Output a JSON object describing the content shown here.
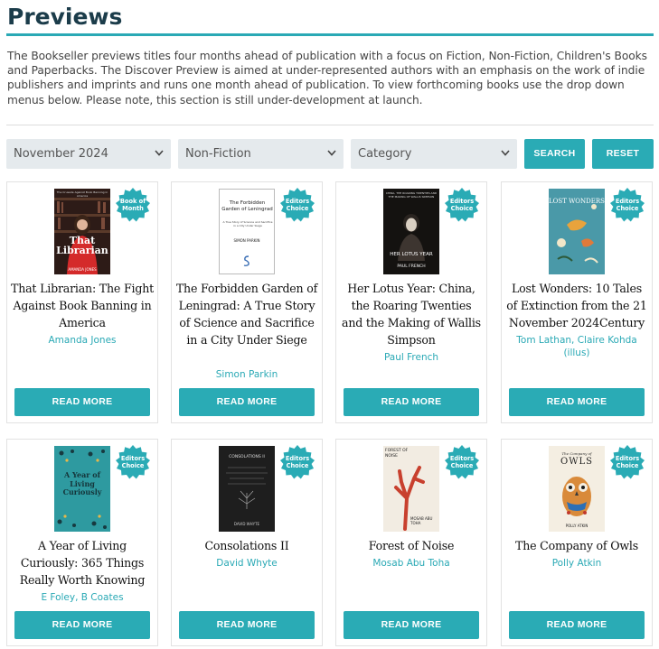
{
  "page": {
    "title": "Previews",
    "intro": "The Bookseller previews titles four months ahead of publication with a focus on Fiction, Non-Fiction, Children's Books and Paperbacks. The Discover Preview is aimed at under-represented authors with an emphasis on the work of indie publishers and imprints and runs one month ahead of publication. To view forthcoming books use the drop down menus below. Please note, this section is still under-development at launch."
  },
  "filters": {
    "month": "November 2024",
    "type": "Non-Fiction",
    "category": "Category",
    "search_label": "SEARCH",
    "reset_label": "RESET"
  },
  "colors": {
    "accent": "#2aabb5",
    "title": "#1b3c4a",
    "select_bg": "#e5eaed"
  },
  "books": [
    {
      "title": "That Librarian: The Fight Against Book Banning in America",
      "authors": "Amanda Jones",
      "badge": "Book of Month",
      "read_more": "READ MORE",
      "cover": {
        "top_text": "The Crusade Against Book Banning in America",
        "title": "That Librarian",
        "author": "AMANDA JONES"
      }
    },
    {
      "title": "The Forbidden Garden of Leningrad: A True Story of Science and Sacrifice in a City Under Siege",
      "authors": "Simon Parkin",
      "badge": "Editors Choice",
      "read_more": "READ MORE",
      "cover": {
        "title": "The Forbidden Garden of Leningrad",
        "subtitle": "A True Story of Science and Sacrifice in a City Under Siege",
        "author": "SIMON PARKIN"
      }
    },
    {
      "title": "Her Lotus Year: China, the Roaring Twenties and the Making of Wallis Simpson",
      "authors": "Paul French",
      "badge": "Editors Choice",
      "read_more": "READ MORE",
      "cover": {
        "top_text": "CHINA, THE ROARING TWENTIES AND THE MAKING OF WALLIS SIMPSON",
        "title": "HER LOTUS YEAR",
        "author": "PAUL FRENCH"
      }
    },
    {
      "title": "Lost Wonders: 10 Tales of Extinction from the 21 November 2024Century",
      "authors": "Tom Lathan, Claire Kohda (illus)",
      "badge": "Editors Choice",
      "read_more": "READ MORE",
      "cover": {
        "title": "LOST WONDERS"
      }
    },
    {
      "title": "A Year of Living Curiously: 365 Things Really Worth Knowing",
      "authors": "E Foley, B Coates",
      "badge": "Editors Choice",
      "read_more": "READ MORE",
      "cover": {
        "title": "A Year of Living Curiously"
      }
    },
    {
      "title": "Consolations II",
      "authors": "David Whyte",
      "badge": "Editors Choice",
      "read_more": "READ MORE",
      "cover": {
        "title": "CONSOLATIONS II",
        "author": "DAVID WHYTE"
      }
    },
    {
      "title": "Forest of Noise",
      "authors": "Mosab Abu Toha",
      "badge": "Editors Choice",
      "read_more": "READ MORE",
      "cover": {
        "title": "FOREST OF NOISE",
        "author": "MOSAB ABU TOHA"
      }
    },
    {
      "title": "The Company of Owls",
      "authors": "Polly Atkin",
      "badge": "Editors Choice",
      "read_more": "READ MORE",
      "cover": {
        "top_text": "The Company of",
        "title": "OWLS",
        "author": "POLLY ATKIN"
      }
    }
  ]
}
